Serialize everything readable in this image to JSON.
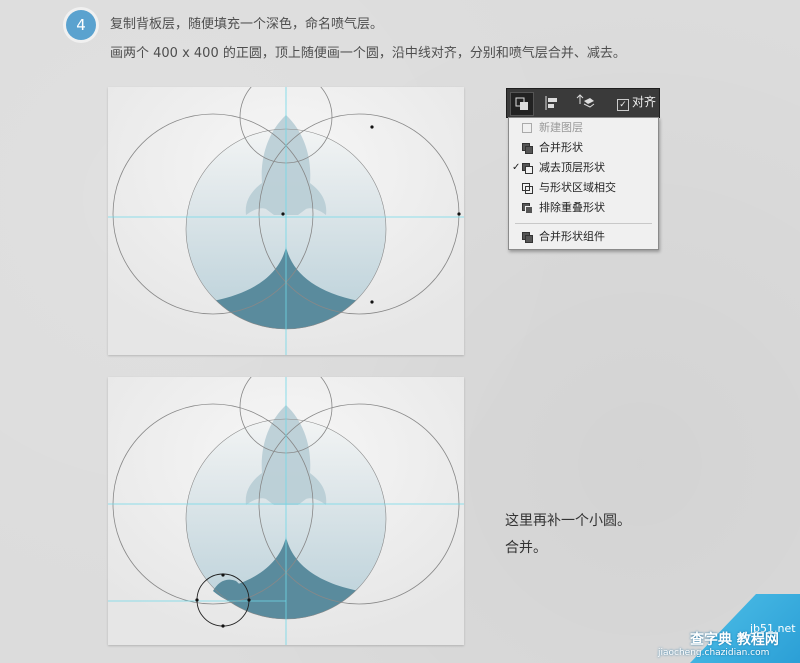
{
  "step": {
    "number": "4",
    "line1": "复制背板层，随便填充一个深色，命名喷气层。",
    "line2": "画两个 400 x 400 的正圆，顶上随便画一个圆，沿中线对齐，分别和喷气层合并、减去。"
  },
  "toolbar": {
    "check_label": "对齐"
  },
  "menu": {
    "items": [
      {
        "label": "新建图层",
        "disabled": true,
        "checked": false
      },
      {
        "label": "合并形状",
        "disabled": false,
        "checked": false
      },
      {
        "label": "减去顶层形状",
        "disabled": false,
        "checked": true
      },
      {
        "label": "与形状区域相交",
        "disabled": false,
        "checked": false
      },
      {
        "label": "排除重叠形状",
        "disabled": false,
        "checked": false
      },
      {
        "label": "合并形状组件",
        "disabled": false,
        "checked": false
      }
    ],
    "checkmark": "✓"
  },
  "notes": {
    "line1": "这里再补一个小圆。",
    "line2": "合并。"
  },
  "watermark": {
    "text1": "查字典 教程网",
    "text2": "jb51.net",
    "text3": "jiaocheng.chazidian.com"
  },
  "colors": {
    "badge": "#5aa2cf",
    "rocket": "#b8cdd5",
    "circle_fill_top": "#dfe7ea",
    "circle_fill_bottom": "#b9d0d9",
    "dark_shape": "#5a8b9d",
    "guide": "#6fd8e8"
  }
}
